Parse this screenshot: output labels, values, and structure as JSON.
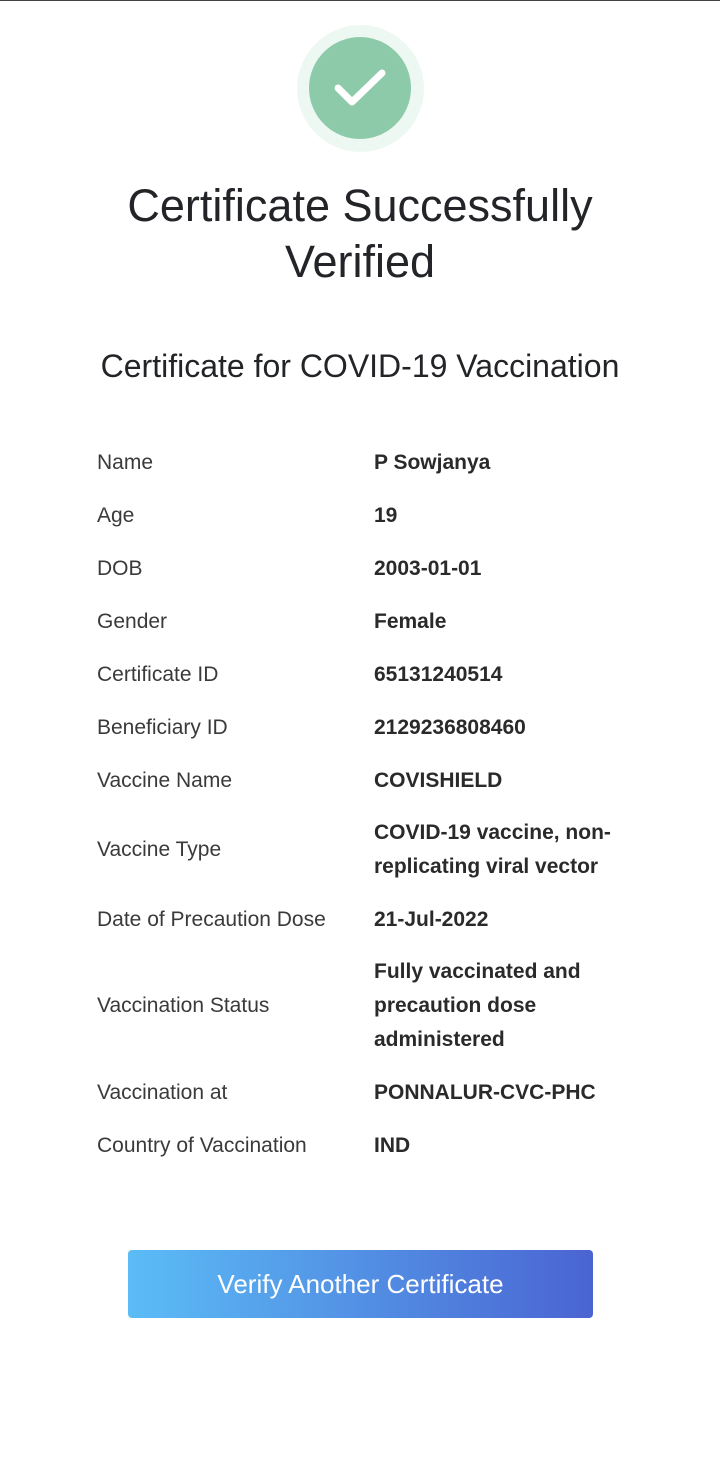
{
  "status": {
    "icon": "checkmark-icon",
    "title": "Certificate Successfully Verified",
    "subtitle": "Certificate for COVID-19 Vaccination"
  },
  "details": [
    {
      "label": "Name",
      "value": "P Sowjanya"
    },
    {
      "label": "Age",
      "value": "19"
    },
    {
      "label": "DOB",
      "value": "2003-01-01"
    },
    {
      "label": "Gender",
      "value": "Female"
    },
    {
      "label": "Certificate ID",
      "value": "65131240514"
    },
    {
      "label": "Beneficiary ID",
      "value": "2129236808460"
    },
    {
      "label": "Vaccine Name",
      "value": "COVISHIELD"
    },
    {
      "label": "Vaccine Type",
      "value": "COVID-19 vaccine, non-replicating viral vector"
    },
    {
      "label": "Date of Precaution Dose",
      "value": "21-Jul-2022"
    },
    {
      "label": "Vaccination Status",
      "value": "Fully vaccinated and precaution dose administered"
    },
    {
      "label": "Vaccination at",
      "value": "PONNALUR-CVC-PHC"
    },
    {
      "label": "Country of Vaccination",
      "value": "IND"
    }
  ],
  "actions": {
    "verify_another_label": "Verify Another Certificate"
  },
  "colors": {
    "success_green": "#8ccaaa",
    "success_halo": "#eef8f3",
    "button_gradient_start": "#5bbcf6",
    "button_gradient_end": "#4a64d2"
  }
}
